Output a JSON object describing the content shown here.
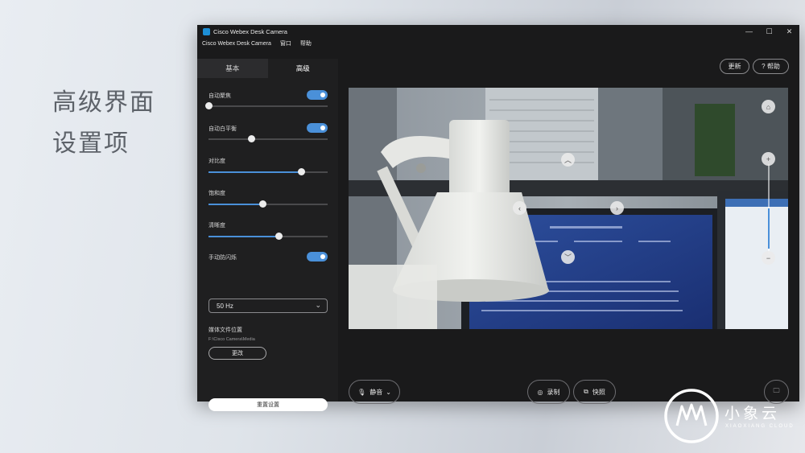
{
  "slide": {
    "heading_line1": "高级界面",
    "heading_line2": "设置项"
  },
  "window": {
    "title": "Cisco Webex Desk Camera",
    "controls": [
      "—",
      "☐",
      "✕"
    ]
  },
  "menubar": {
    "items": [
      "Cisco Webex Desk Camera",
      "窗口",
      "帮助"
    ]
  },
  "sidebar": {
    "tabs": [
      {
        "label": "基本",
        "active": false
      },
      {
        "label": "高级",
        "active": true
      }
    ],
    "auto_focus": {
      "label": "自动聚焦",
      "enabled": true,
      "value": 0.0
    },
    "auto_white_balance": {
      "label": "自动白平衡",
      "enabled": true,
      "value": 0.36
    },
    "contrast": {
      "label": "对比度",
      "value": 0.78
    },
    "saturation": {
      "label": "饱和度",
      "value": 0.45
    },
    "sharpness": {
      "label": "清晰度",
      "value": 0.59
    },
    "anti_flicker": {
      "label": "手动防闪烁",
      "enabled": true,
      "selected": "50 Hz"
    },
    "media_location": {
      "label": "媒体文件位置",
      "path": "F:\\Cisco Camera\\Media",
      "change_label": "更改"
    },
    "reset_label": "重置设置",
    "accent_color": "#4a90d9"
  },
  "toolbar": {
    "update_label": "更新",
    "help_label": "? 帮助"
  },
  "bottom_bar": {
    "mute_label": "静音",
    "record_label": "录制",
    "snapshot_label": "快照"
  },
  "icons": {
    "mic": "mic-icon",
    "record": "record-icon",
    "snapshot": "snapshot-icon",
    "folder": "folder-icon",
    "pan_up": "chevron-up-icon",
    "pan_down": "chevron-down-icon",
    "pan_left": "chevron-left-icon",
    "pan_right": "chevron-right-icon",
    "zoom_in": "plus-icon",
    "zoom_out": "minus-icon",
    "home": "home-icon"
  },
  "branding": {
    "name": "小象云",
    "sub": "XIAOXIANG CLOUD"
  }
}
